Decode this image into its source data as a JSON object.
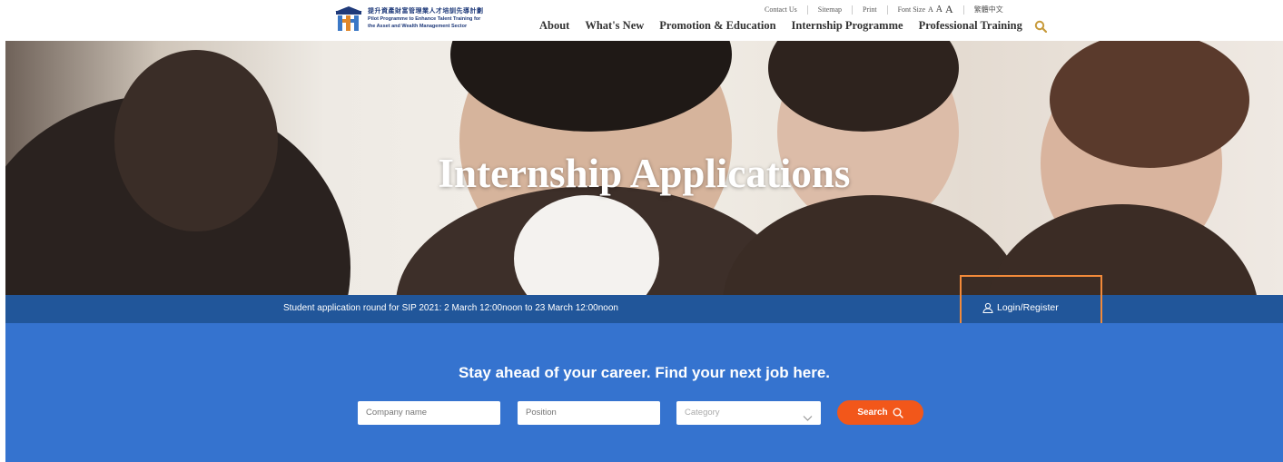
{
  "logo": {
    "name_zh": "提升資產財富管理業人才培訓先導計劃",
    "name_en_line1": "Pilot Programme to Enhance Talent Training for",
    "name_en_line2": "the Asset and Wealth Management Sector"
  },
  "utility_nav": {
    "contact": "Contact Us",
    "sitemap": "Sitemap",
    "print": "Print",
    "font_size_label": "Font Size",
    "font_sizes": [
      "A",
      "A",
      "A"
    ],
    "language": "繁體中文"
  },
  "main_nav": {
    "items": [
      "About",
      "What's New",
      "Promotion & Education",
      "Internship Programme",
      "Professional Training"
    ],
    "search_icon": "search-icon"
  },
  "hero": {
    "title": "Internship Applications"
  },
  "infobar": {
    "notice": "Student application round for SIP 2021: 2 March 12:00noon to 23 March 12:00noon",
    "login_label": "Login/Register",
    "login_icon": "user-icon"
  },
  "search": {
    "tagline": "Stay ahead of your career. Find your next job here.",
    "company_placeholder": "Company name",
    "position_placeholder": "Position",
    "category_value": "Category",
    "button_label": "Search"
  },
  "colors": {
    "nav_text": "#333333",
    "infobar_bg": "#21569a",
    "panel_bg": "#3573cf",
    "search_button": "#f2571a",
    "highlight_box": "#f28a3a",
    "search_icon_accent": "#c79a3a"
  }
}
